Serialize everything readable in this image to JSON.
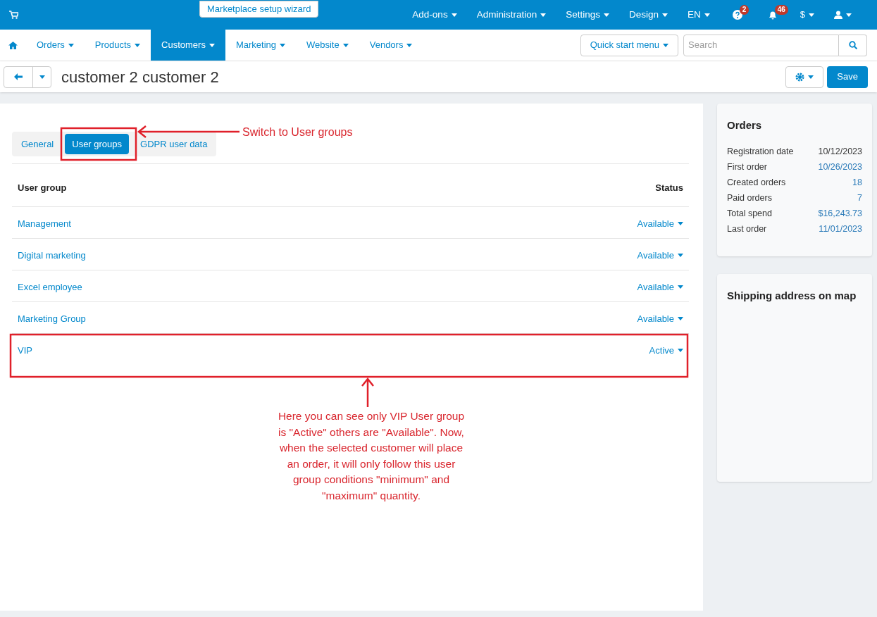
{
  "top_bar": {
    "wizard_button": "Marketplace setup wizard",
    "menus": [
      "Add-ons",
      "Administration",
      "Settings",
      "Design",
      "EN"
    ],
    "badges": [
      {
        "kind": "help",
        "count": "2"
      },
      {
        "kind": "bell",
        "count": "46"
      }
    ],
    "currency": "$"
  },
  "nav": {
    "items": [
      {
        "label": "Orders",
        "selected": false
      },
      {
        "label": "Products",
        "selected": false
      },
      {
        "label": "Customers",
        "selected": true
      },
      {
        "label": "Marketing",
        "selected": false
      },
      {
        "label": "Website",
        "selected": false
      },
      {
        "label": "Vendors",
        "selected": false
      }
    ],
    "quick_start": "Quick start menu",
    "search": {
      "placeholder": "Search"
    }
  },
  "title_bar": {
    "title": "customer 2 customer 2",
    "save_button": "Save"
  },
  "tabs": [
    {
      "label": "General",
      "selected": false
    },
    {
      "label": "User groups",
      "selected": true
    },
    {
      "label": "GDPR user data",
      "selected": false
    }
  ],
  "table": {
    "columns": [
      "User group",
      "Status"
    ],
    "rows": [
      {
        "name": "Management",
        "status": "Available"
      },
      {
        "name": "Digital marketing",
        "status": "Available"
      },
      {
        "name": "Excel employee",
        "status": "Available"
      },
      {
        "name": "Marketing Group",
        "status": "Available"
      },
      {
        "name": "VIP",
        "status": "Active"
      }
    ]
  },
  "orders_card": {
    "title": "Orders",
    "rows": [
      {
        "label": "Registration date",
        "value": "10/12/2023",
        "link": false
      },
      {
        "label": "First order",
        "value": "10/26/2023",
        "link": true
      },
      {
        "label": "Created orders",
        "value": "18",
        "link": true
      },
      {
        "label": "Paid orders",
        "value": "7",
        "link": true
      },
      {
        "label": "Total spend",
        "value": "$16,243.73",
        "link": true
      },
      {
        "label": "Last order",
        "value": "11/01/2023",
        "link": true
      }
    ]
  },
  "map_card": {
    "title": "Shipping address on map"
  },
  "annotations": {
    "tab_callout": "Switch to User groups",
    "row_callout": "Here you can see only VIP User group is \"Active\" others are \"Available\". Now, when the selected customer will place an order, it will only follow this user group conditions \"minimum\" and \"maximum\" quantity."
  }
}
